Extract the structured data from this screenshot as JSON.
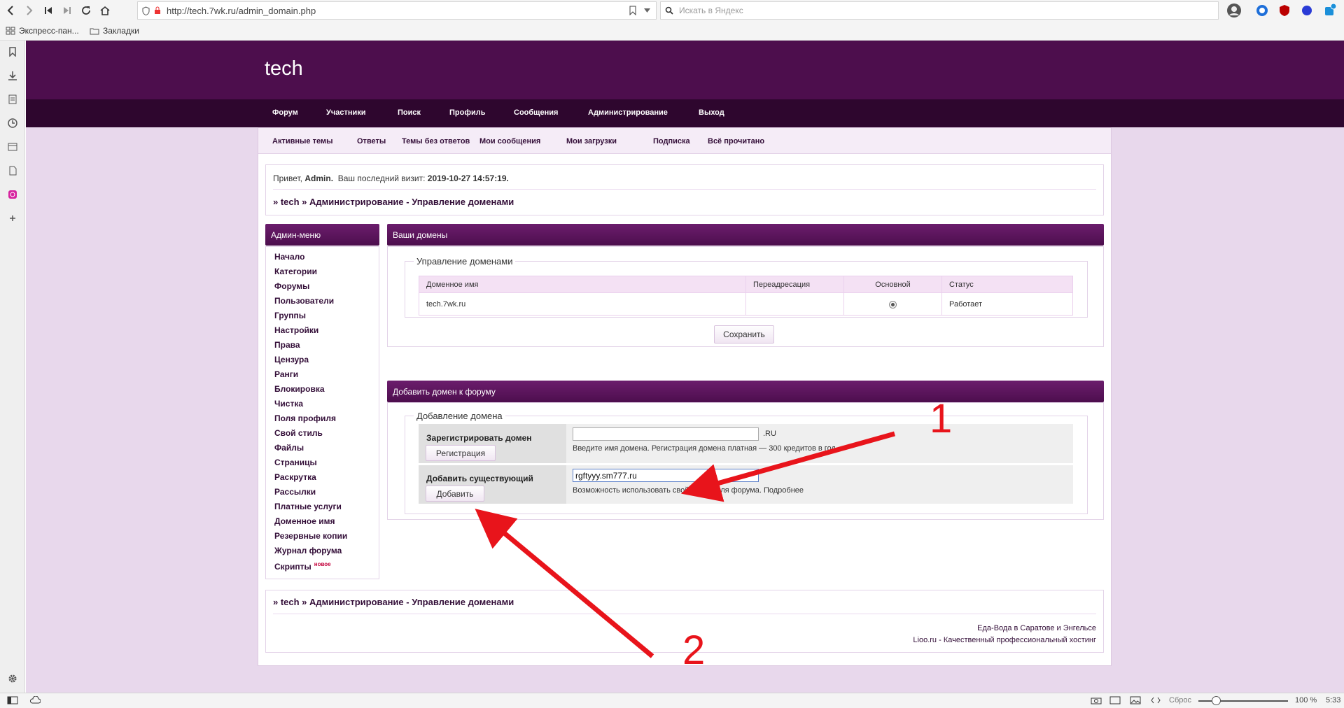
{
  "browser": {
    "url": "http://tech.7wk.ru/admin_domain.php",
    "search_placeholder": "Искать в Яндекс",
    "bookmarks": [
      "Экспресс-пан...",
      "Закладки"
    ],
    "status": {
      "reset": "Сброс",
      "zoom": "100 %",
      "time": "5:33"
    }
  },
  "site": {
    "logo": "tech",
    "main_nav": [
      "Форум",
      "Участники",
      "Поиск",
      "Профиль",
      "Сообщения",
      "Администрирование",
      "Выход"
    ],
    "sub_nav": [
      "Активные темы",
      "Ответы",
      "Темы без ответов",
      "Мои сообщения",
      "Мои загрузки",
      "Подписка",
      "Всё прочитано"
    ],
    "greeting": {
      "hello": "Привет,",
      "user": "Admin.",
      "last_visit_label": "Ваш последний визит:",
      "last_visit": "2019-10-27 14:57:19."
    },
    "breadcrumb": "» tech » Администрирование - Управление доменами"
  },
  "admin_menu": {
    "title": "Админ-меню",
    "items": [
      "Начало",
      "Категории",
      "Форумы",
      "Пользователи",
      "Группы",
      "Настройки",
      "Права",
      "Цензура",
      "Ранги",
      "Блокировка",
      "Чистка",
      "Поля профиля",
      "Свой стиль",
      "Файлы",
      "Страницы",
      "Раскрутка",
      "Рассылки",
      "Платные услуги",
      "Доменное имя",
      "Резервные копии",
      "Журнал форума",
      "Скрипты"
    ],
    "new_badge": "новое"
  },
  "domains": {
    "title": "Ваши домены",
    "legend": "Управление доменами",
    "columns": [
      "Доменное имя",
      "Переадресация",
      "Основной",
      "Статус"
    ],
    "rows": [
      {
        "name": "tech.7wk.ru",
        "redirect": "",
        "primary": true,
        "status": "Работает"
      }
    ],
    "save_label": "Сохранить"
  },
  "add_domain": {
    "title": "Добавить домен к форуму",
    "legend": "Добавление домена",
    "register": {
      "label": "Зарегистрировать домен",
      "value": "",
      "suffix": ".RU",
      "button": "Регистрация",
      "hint": "Введите имя домена. Регистрация домена платная — 300 кредитов в год."
    },
    "existing": {
      "label": "Добавить существующий",
      "value": "rgftyyy.sm777.ru",
      "button": "Добавить",
      "hint": "Возможность использовать свой домен для форума. Подробнее"
    }
  },
  "footer": {
    "breadcrumb": "» tech » Администрирование - Управление доменами",
    "links": [
      "Еда-Вода в Саратове и Энгельсе",
      "Lioo.ru - Качественный профессиональный хостинг"
    ]
  },
  "annotations": {
    "label1": "1",
    "label2": "2",
    "color": "#e8141b"
  }
}
